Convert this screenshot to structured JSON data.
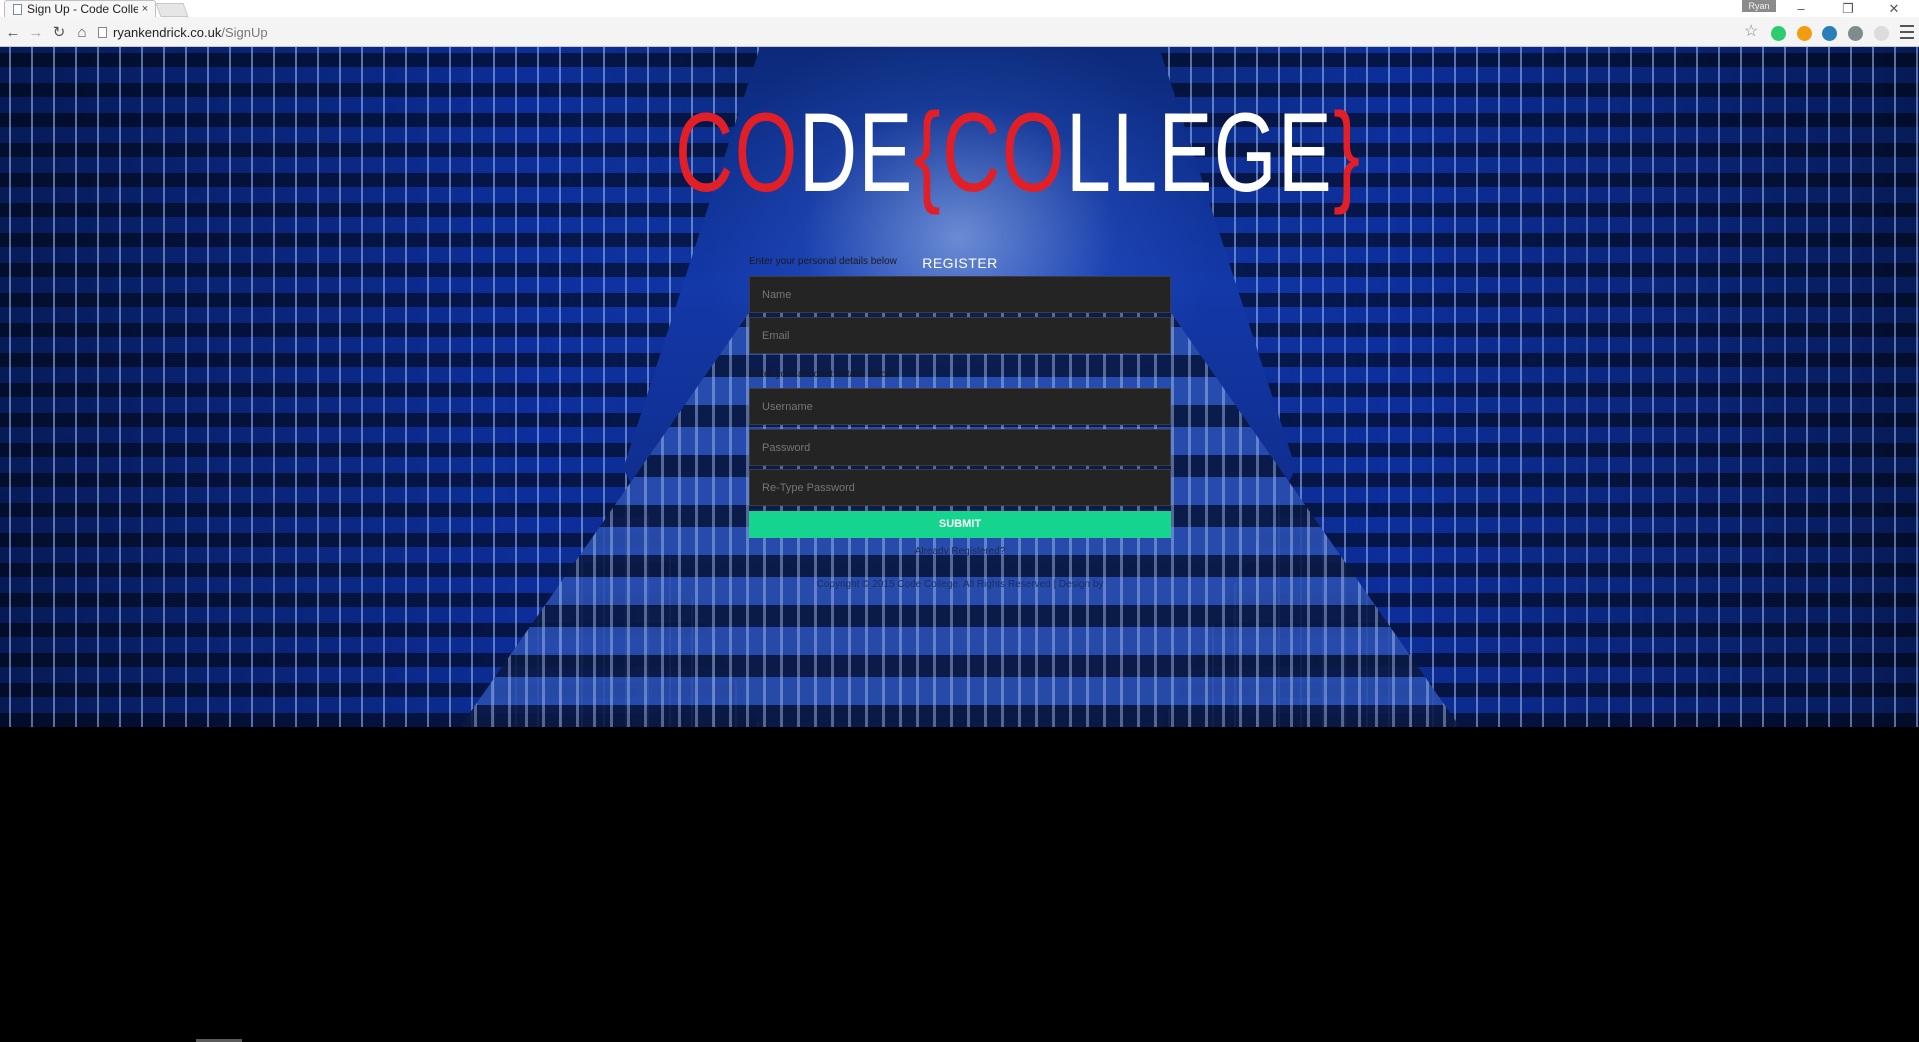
{
  "browser": {
    "tab_title": "Sign Up - Code Colle",
    "tab_close": "×",
    "profile_name": "Ryan",
    "url_host": "ryankendrick.co.uk",
    "url_path": "/SignUp",
    "window_controls": [
      "–",
      "❐",
      "✕"
    ],
    "nav_icons": [
      "back-arrow-icon",
      "forward-arrow-icon",
      "reload-icon",
      "home-icon"
    ],
    "extension_colors": [
      "#2ecc71",
      "#f39c12",
      "#2980b9",
      "#7f8c8d",
      "#bdc3c7"
    ]
  },
  "logo": {
    "part1_red": "CO",
    "part1_white": "DE",
    "open_brace": "{",
    "part2_red": "CO",
    "part2_white": "LLEGE",
    "close_brace": "}"
  },
  "form": {
    "title": "REGISTER",
    "personal_note": "Enter your personal details below",
    "name_placeholder": "Name",
    "email_placeholder": "Email",
    "account_note": "Enter your account details below",
    "username_placeholder": "Username",
    "password_placeholder": "Password",
    "retype_placeholder": "Re-Type Password",
    "submit_label": "SUBMIT",
    "already_registered": "Already Registered?"
  },
  "footer": {
    "copyright": "Copyright © 2015 Code College. All Rights Reserved | Design by"
  },
  "colors": {
    "accent_submit": "#15d48d",
    "logo_red": "#e21f26",
    "field_bg": "#242424"
  }
}
